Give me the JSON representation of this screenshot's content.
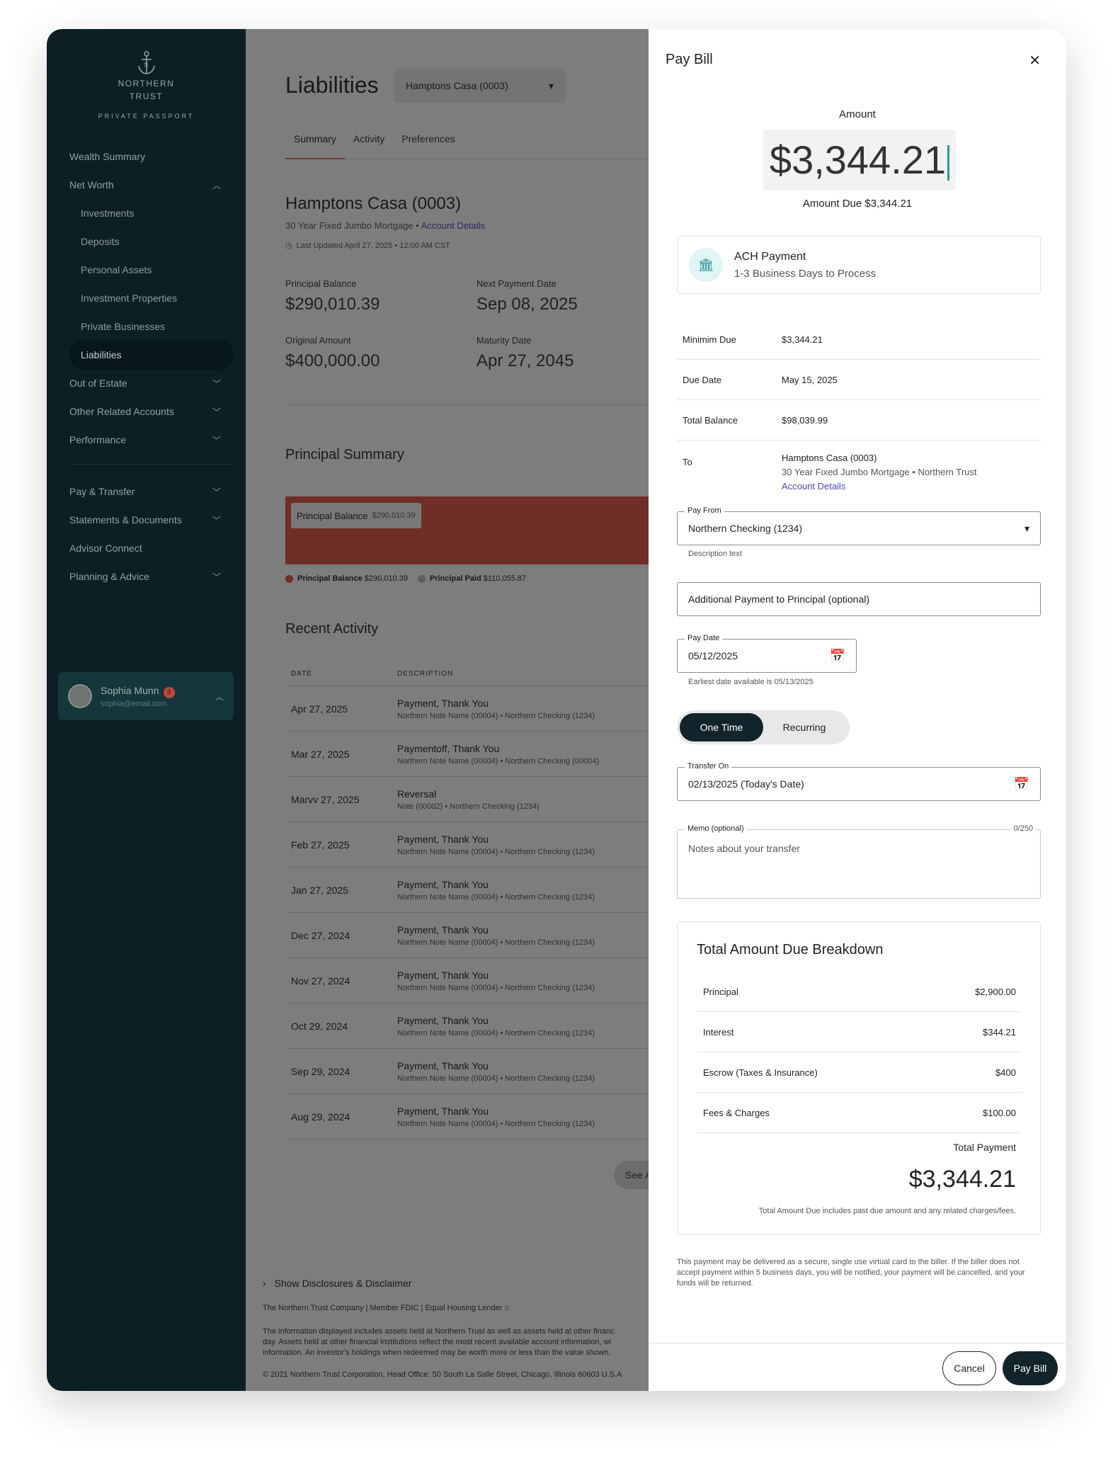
{
  "sidebar": {
    "brand_line1": "NORTHERN",
    "brand_line2": "TRUST",
    "brand_tagline": "PRIVATE PASSPORT",
    "items": [
      {
        "label": "Wealth Summary"
      },
      {
        "label": "Net Worth"
      },
      {
        "label": "Investments"
      },
      {
        "label": "Deposits"
      },
      {
        "label": "Personal Assets"
      },
      {
        "label": "Investment Properties"
      },
      {
        "label": "Private Businesses"
      },
      {
        "label": "Liabilities"
      },
      {
        "label": "Out of Estate"
      },
      {
        "label": "Other Related Accounts"
      },
      {
        "label": "Performance"
      },
      {
        "label": "Pay & Transfer"
      },
      {
        "label": "Statements & Documents"
      },
      {
        "label": "Advisor Connect"
      },
      {
        "label": "Planning & Advice"
      }
    ],
    "user": {
      "name": "Sophia Munn",
      "email": "sophia@email.com",
      "badge": "3"
    }
  },
  "main": {
    "title": "Liabilities",
    "account_select": "Hamptons Casa (0003)",
    "tabs": [
      "Summary",
      "Activity",
      "Preferences"
    ],
    "account_name": "Hamptons Casa (0003)",
    "account_type": "30 Year Fixed Jumbo Mortgage",
    "account_details_link": "Account Details",
    "last_updated": "Last Updated  April 27, 2025 • 12:00 AM CST",
    "principal_balance_label": "Principal Balance",
    "principal_balance": "$290,010.39",
    "next_payment_label": "Next Payment Date",
    "next_payment": "Sep 08, 2025",
    "original_amount_label": "Original Amount",
    "original_amount": "$400,000.00",
    "maturity_label": "Maturity Date",
    "maturity": "Apr 27, 2045",
    "principal_summary_title": "Principal Summary",
    "bar_label": "Principal Balance",
    "bar_value": "$290,010.39",
    "legend_balance_label": "Principal Balance",
    "legend_balance_value": "$290,010.39",
    "legend_paid_label": "Principal Paid",
    "legend_paid_value": "$110,055.87",
    "colors": {
      "balance": "#e05042",
      "paid": "#bdbdbd"
    },
    "recent_activity_title": "Recent Activity",
    "col_date": "DATE",
    "col_desc": "DESCRIPTION",
    "activity": [
      {
        "date": "Apr 27, 2025",
        "title": "Payment, Thank You",
        "detail": "Northern Note Name (00004) • Northern Checking (1234)"
      },
      {
        "date": "Mar 27, 2025",
        "title": "Paymentoff, Thank You",
        "detail": "Northern Note Name (00004) • Northern Checking (00004)"
      },
      {
        "date": "Marvv 27, 2025",
        "title": "Reversal",
        "detail": "Note (00002) • Northern Checking (1234)"
      },
      {
        "date": "Feb 27, 2025",
        "title": "Payment, Thank You",
        "detail": "Northern Note Name (00004) • Northern Checking (1234)"
      },
      {
        "date": "Jan 27, 2025",
        "title": "Payment, Thank You",
        "detail": "Northern Note Name (00004) • Northern Checking (1234)"
      },
      {
        "date": "Dec 27, 2024",
        "title": "Payment, Thank You",
        "detail": "Northern Note Name (00004) • Northern Checking (1234)"
      },
      {
        "date": "Nov 27, 2024",
        "title": "Payment, Thank You",
        "detail": "Northern Note Name (00004) • Northern Checking (1234)"
      },
      {
        "date": "Oct 29, 2024",
        "title": "Payment, Thank You",
        "detail": "Northern Note Name (00004) • Northern Checking (1234)"
      },
      {
        "date": "Sep 29, 2024",
        "title": "Payment, Thank You",
        "detail": "Northern Note Name (00004) • Northern Checking (1234)"
      },
      {
        "date": "Aug 29, 2024",
        "title": "Payment, Thank You",
        "detail": "Northern Note Name (00004) • Northern Checking (1234)"
      }
    ],
    "see_all": "See A",
    "disclosures": "Show Disclosures & Disclaimer",
    "legal_line": "The Northern Trust Company    |    Member FDIC    |    Equal Housing Lender",
    "legal_p1": "The information displayed includes assets held at Northern Trust as well as assets held at other financ",
    "legal_p2": "day. Assets held at other financial institutions reflect the most recent available account information, wi",
    "legal_p3": "information. An investor's holdings when redeemed may be worth more or less than the value shown.",
    "copyright": "© 2021 Northern Trust Corporation. Head Office: 50 South La Salle Street, Chicago, Illinois 60603 U.S.A"
  },
  "panel": {
    "title": "Pay Bill",
    "amount_label": "Amount",
    "amount": "$3,344.21",
    "amount_due": "Amount Due $3,344.21",
    "ach_title": "ACH Payment",
    "ach_sub": "1-3 Business Days to Process",
    "details": [
      {
        "key": "Minimim Due",
        "value": "$3,344.21"
      },
      {
        "key": "Due Date",
        "value": "May 15, 2025"
      },
      {
        "key": "Total Balance",
        "value": "$98,039.99"
      }
    ],
    "to_label": "To",
    "to_name": "Hamptons Casa (0003)",
    "to_sub": "30 Year Fixed Jumbo Mortgage  •  Northern Trust",
    "to_link": "Account Details",
    "pay_from_label": "Pay From",
    "pay_from_value": "Northern Checking (1234)",
    "pay_from_help": "Description text",
    "additional_payment": "Additional Payment to Principal (optional)",
    "pay_date_label": "Pay Date",
    "pay_date": "05/12/2025",
    "pay_date_help": "Earliest date available is 05/13/2025",
    "toggle_one_time": "One Time",
    "toggle_recurring": "Recurring",
    "transfer_on_label": "Transfer On",
    "transfer_on": "02/13/2025 (Today's Date)",
    "memo_label": "Memo (optional)",
    "memo_count": "0/250",
    "memo_placeholder": "Notes about your transfer",
    "breakdown_title": "Total Amount Due Breakdown",
    "breakdown": [
      {
        "label": "Principal",
        "value": "$2,900.00"
      },
      {
        "label": "Interest",
        "value": "$344.21"
      },
      {
        "label": "Escrow (Taxes & Insurance)",
        "value": "$400"
      },
      {
        "label": "Fees & Charges",
        "value": "$100.00"
      }
    ],
    "total_payment_label": "Total Payment",
    "total_payment": "$3,344.21",
    "breakdown_note": "Total Amount Due includes past due amount and any related charges/fees.",
    "fine_print": "This payment may be delivered as a secure, single use virtual card to the biller. If the biller does not accept payment within 5 business days, you will be notified, your payment will be cancelled, and your funds will be returned.",
    "cancel": "Cancel",
    "pay": "Pay Bill"
  }
}
